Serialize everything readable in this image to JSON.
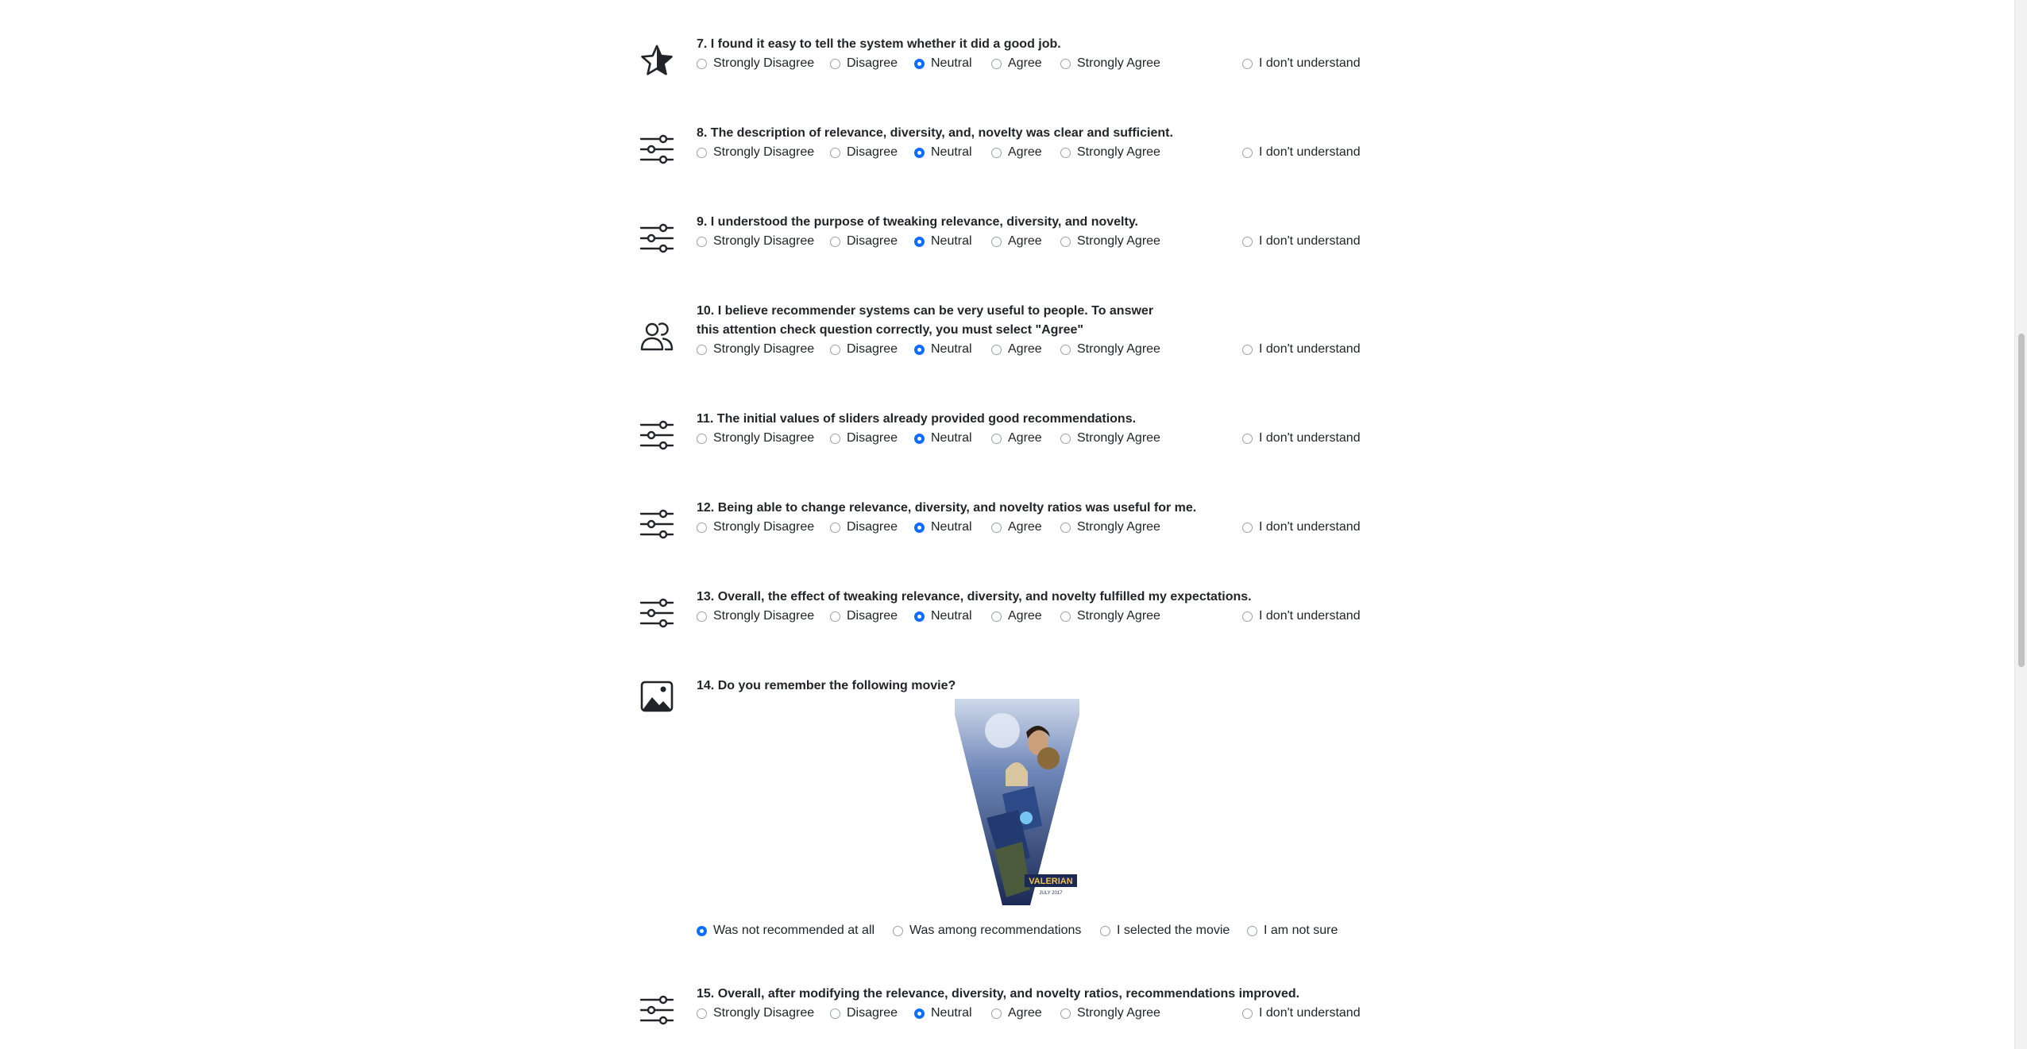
{
  "likert_options": [
    "Strongly Disagree",
    "Disagree",
    "Neutral",
    "Agree",
    "Strongly Agree"
  ],
  "dont_understand": "I don't understand",
  "questions": [
    {
      "text": "7. I found it easy to tell the system whether it did a good job.",
      "icon": "star-icon",
      "selected": "Neutral"
    },
    {
      "text": "8. The description of relevance, diversity, and, novelty was clear and sufficient.",
      "icon": "sliders-icon",
      "selected": "Neutral"
    },
    {
      "text": "9. I understood the purpose of tweaking relevance, diversity, and novelty.",
      "icon": "sliders-icon",
      "selected": "Neutral"
    },
    {
      "text": "10. I believe recommender systems can be very useful to people. To answer this attention check question correctly, you must select \"Agree\"",
      "icon": "people-icon",
      "selected": "Neutral"
    },
    {
      "text": "11. The initial values of sliders already provided good recommendations.",
      "icon": "sliders-icon",
      "selected": "Neutral"
    },
    {
      "text": "12. Being able to change relevance, diversity, and novelty ratios was useful for me.",
      "icon": "sliders-icon",
      "selected": "Neutral"
    },
    {
      "text": "13. Overall, the effect of tweaking relevance, diversity, and novelty fulfilled my expectations.",
      "icon": "sliders-icon",
      "selected": "Neutral"
    }
  ],
  "movie_question": {
    "text": "14. Do you remember the following movie?",
    "icon": "image-icon",
    "poster_title": "VALERIAN",
    "poster_date": "JULY 2017",
    "options": [
      "Was not recommended at all",
      "Was among recommendations",
      "I selected the movie",
      "I am not sure"
    ],
    "selected": "Was not recommended at all"
  },
  "last_question": {
    "text": "15. Overall, after modifying the relevance, diversity, and novelty ratios, recommendations improved.",
    "icon": "sliders-icon",
    "selected": "Neutral"
  },
  "colors": {
    "accent": "#0d6efd",
    "text": "#212529",
    "radio_border": "#9aa0a6"
  }
}
